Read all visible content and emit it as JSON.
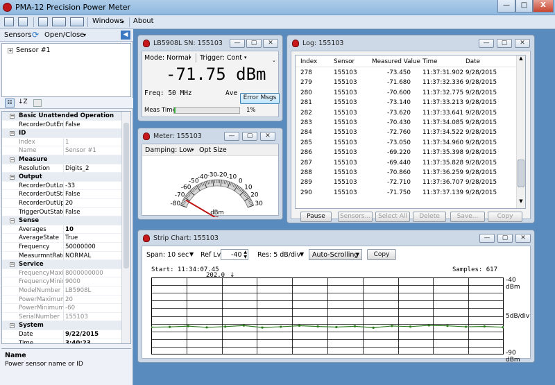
{
  "app": {
    "title": "PMA-12 Precision Power Meter"
  },
  "caption_buttons": {
    "minimize": "—",
    "maximize": "□",
    "close": "X"
  },
  "menubar": {
    "windows": "Windows",
    "about": "About"
  },
  "left": {
    "sensors_label": "Sensors",
    "open_close_label": "Open/Close",
    "tree_item": "Sensor #1",
    "properties": [
      {
        "type": "cat",
        "k": "Basic Unattended Operation"
      },
      {
        "k": "RecorderOutEnal",
        "v": "False"
      },
      {
        "type": "cat",
        "k": "ID"
      },
      {
        "k": "Index",
        "v": "1",
        "gray": true
      },
      {
        "k": "Name",
        "v": "Sensor #1",
        "gray": true
      },
      {
        "type": "cat",
        "k": "Measure"
      },
      {
        "k": "Resolution",
        "v": "Digits_2"
      },
      {
        "type": "cat",
        "k": "Output"
      },
      {
        "k": "RecorderOutLow",
        "v": "-33"
      },
      {
        "k": "RecorderOutStat",
        "v": "False"
      },
      {
        "k": "RecorderOutUpp",
        "v": "20"
      },
      {
        "k": "TriggerOutState",
        "v": "False"
      },
      {
        "type": "cat",
        "k": "Sense"
      },
      {
        "k": "Averages",
        "v": "10",
        "bold": true
      },
      {
        "k": "AverageState",
        "v": "True"
      },
      {
        "k": "Frequency",
        "v": "50000000"
      },
      {
        "k": "MeasurmntRate",
        "v": "NORMAL"
      },
      {
        "type": "cat",
        "k": "Service"
      },
      {
        "k": "FrequencyMaxim",
        "v": "8000000000",
        "gray": true
      },
      {
        "k": "FrequencyMinim",
        "v": "9000",
        "gray": true
      },
      {
        "k": "ModelNumber",
        "v": "LB5908L",
        "gray": true
      },
      {
        "k": "PowerMaximum",
        "v": "20",
        "gray": true
      },
      {
        "k": "PowerMinimum",
        "v": "-60",
        "gray": true
      },
      {
        "k": "SerialNumber",
        "v": "155103",
        "gray": true
      },
      {
        "type": "cat",
        "k": "System"
      },
      {
        "k": "Date",
        "v": "9/22/2015",
        "bold": true
      },
      {
        "k": "Time",
        "v": "3:40:23",
        "bold": true
      }
    ],
    "desc_title": "Name",
    "desc_text": "Power sensor name or ID"
  },
  "meas": {
    "title": "LB5908L SN: 155103",
    "mode": "Mode: Normal",
    "trigger": "Trigger: Cont",
    "reading": "-71.75 dBm",
    "freq": "Freq:  50 MHz",
    "ave": "Ave",
    "error_btn": "Error Msgs",
    "meas_time": "Meas Time",
    "progress_text": "1%",
    "progress": 0.01
  },
  "meter": {
    "title": "Meter: 155103",
    "damping": "Damping: Low",
    "opt_size": "Opt Size",
    "unit": "dBm",
    "ticks": [
      "-80",
      "-70",
      "-60",
      "-50",
      "-40",
      "-30",
      "-20",
      "-10",
      "0",
      "10",
      "20",
      "30"
    ],
    "value": -71.75,
    "min": -80,
    "max": 30
  },
  "log": {
    "title": "Log: 155103",
    "columns": [
      "Index",
      "Sensor",
      "Measured Value",
      "Time",
      "Date"
    ],
    "rows": [
      [
        "278",
        "155103",
        "-73.450",
        "11:37:31.902",
        "9/28/2015"
      ],
      [
        "279",
        "155103",
        "-71.680",
        "11:37:32.336",
        "9/28/2015"
      ],
      [
        "280",
        "155103",
        "-70.600",
        "11:37:32.775",
        "9/28/2015"
      ],
      [
        "281",
        "155103",
        "-73.140",
        "11:37:33.213",
        "9/28/2015"
      ],
      [
        "282",
        "155103",
        "-73.620",
        "11:37:33.641",
        "9/28/2015"
      ],
      [
        "283",
        "155103",
        "-70.430",
        "11:37:34.085",
        "9/28/2015"
      ],
      [
        "284",
        "155103",
        "-72.760",
        "11:37:34.522",
        "9/28/2015"
      ],
      [
        "285",
        "155103",
        "-73.050",
        "11:37:34.960",
        "9/28/2015"
      ],
      [
        "286",
        "155103",
        "-69.220",
        "11:37:35.398",
        "9/28/2015"
      ],
      [
        "287",
        "155103",
        "-69.440",
        "11:37:35.828",
        "9/28/2015"
      ],
      [
        "288",
        "155103",
        "-70.860",
        "11:37:36.259",
        "9/28/2015"
      ],
      [
        "289",
        "155103",
        "-72.710",
        "11:37:36.707",
        "9/28/2015"
      ],
      [
        "290",
        "155103",
        "-71.750",
        "11:37:37.139",
        "9/28/2015"
      ]
    ],
    "buttons": [
      "Pause",
      "Sensors...",
      "Select All",
      "Delete",
      "Save...",
      "Copy"
    ]
  },
  "strip": {
    "title": "Strip Chart: 155103",
    "span": "Span: 10 sec",
    "ref_label": "Ref Lvl:",
    "ref_value": "-40",
    "res": "Res: 5 dB/div",
    "autoscroll": "Auto-Scrolling",
    "copy": "Copy",
    "start": "Start: 11:34:07.45",
    "samples": "Samples: 617",
    "marker": "202.0",
    "top_label": "-40 dBm",
    "mid_label": "5dB/div",
    "bottom_label": "-90 dBm",
    "series_color": "#2e7d1f"
  },
  "chart_data": {
    "type": "line",
    "ylim": [
      -90,
      -40
    ],
    "values": [
      -72.3,
      -72.1,
      -71.6,
      -72.4,
      -71.9,
      -71.2,
      -72.5,
      -72.0,
      -71.3,
      -71.8,
      -72.2,
      -71.7,
      -72.6,
      -71.5,
      -71.9,
      -71.1,
      -71.4,
      -72.0,
      -71.8,
      -72.3
    ]
  }
}
